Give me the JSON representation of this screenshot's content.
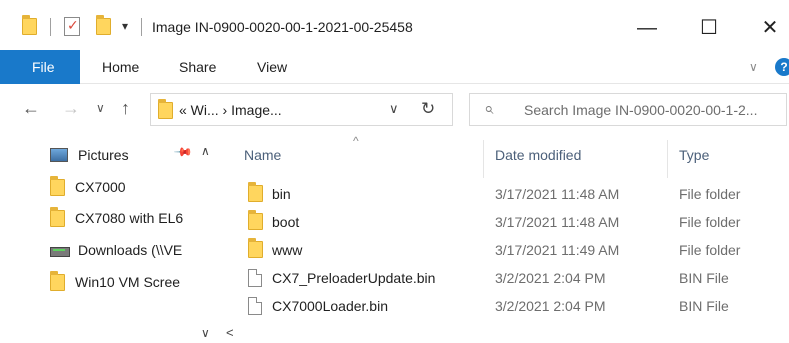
{
  "window": {
    "title": "Image IN-0900-0020-00-1-2021-00-25458",
    "quick_access_arrow": "▾",
    "minimize": "—",
    "maximize": "☐",
    "close": "✕"
  },
  "ribbon": {
    "tabs": [
      {
        "label": "File",
        "active": true
      },
      {
        "label": "Home"
      },
      {
        "label": "Share"
      },
      {
        "label": "View"
      }
    ],
    "expand_chevron": "∨",
    "help": "?"
  },
  "nav": {
    "back": "←",
    "forward": "→",
    "recent": "∨",
    "up": "↑"
  },
  "address": {
    "text": "« Wi... › Image...",
    "dropdown": "∨",
    "refresh": "↻"
  },
  "search": {
    "icon": "⌕",
    "placeholder": "Search Image IN-0900-0020-00-1-2..."
  },
  "navpane": {
    "items": [
      {
        "label": "Pictures",
        "icon": "pictures-icon",
        "pinned": true
      },
      {
        "label": "CX7000",
        "icon": "folder-icon"
      },
      {
        "label": "CX7080 with EL6",
        "icon": "folder-icon"
      },
      {
        "label": "Downloads (\\\\VE",
        "icon": "network-drive-icon"
      },
      {
        "label": "Win10 VM Scree",
        "icon": "folder-icon"
      }
    ],
    "pin_glyph": "📌",
    "scroll_up": "∧",
    "scroll_down": "∨"
  },
  "filelist": {
    "columns": {
      "name": "Name",
      "date": "Date modified",
      "type": "Type"
    },
    "sort_indicator": "^",
    "rows": [
      {
        "name": "bin",
        "date": "3/17/2021 11:48 AM",
        "type": "File folder",
        "icon": "folder-icon"
      },
      {
        "name": "boot",
        "date": "3/17/2021 11:48 AM",
        "type": "File folder",
        "icon": "folder-icon"
      },
      {
        "name": "www",
        "date": "3/17/2021 11:49 AM",
        "type": "File folder",
        "icon": "folder-icon"
      },
      {
        "name": "CX7_PreloaderUpdate.bin",
        "date": "3/2/2021 2:04 PM",
        "type": "BIN File",
        "icon": "file-icon"
      },
      {
        "name": "CX7000Loader.bin",
        "date": "3/2/2021 2:04 PM",
        "type": "BIN File",
        "icon": "file-icon"
      }
    ],
    "hscroll_left": "<"
  },
  "colors": {
    "accent": "#1979ca",
    "folder": "#ffd65e",
    "header_text": "#4c607a"
  }
}
